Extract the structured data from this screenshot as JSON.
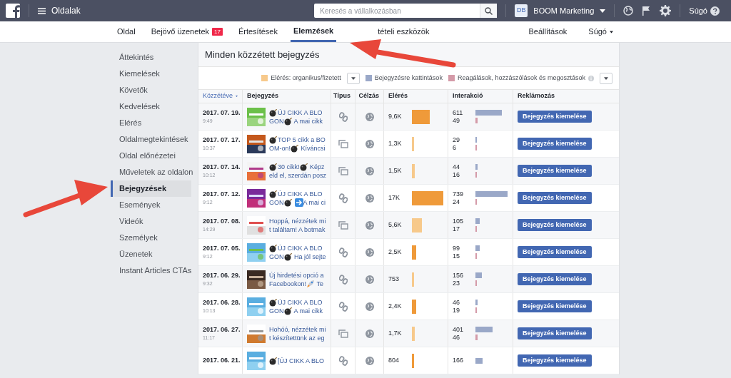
{
  "topbar": {
    "menu_label": "Oldalak",
    "search": {
      "placeholder": "Keresés a vállalkozásban"
    },
    "page": {
      "avatar": "DB",
      "name": "BOOM Marketing"
    },
    "help": "Súgó"
  },
  "nav": {
    "tabs": [
      {
        "label": "Oldal",
        "selected": false
      },
      {
        "label": "Bejövő üzenetek",
        "badge": "17",
        "selected": false
      },
      {
        "label": "Értesítések",
        "selected": false
      },
      {
        "label": "Elemzések",
        "selected": true
      },
      {
        "label": "tételi eszközök",
        "selected": false
      }
    ],
    "right": [
      {
        "label": "Beállítások",
        "dropdown": false
      },
      {
        "label": "Súgó",
        "dropdown": true
      }
    ]
  },
  "sidebar": {
    "items": [
      {
        "label": "Áttekintés",
        "selected": false
      },
      {
        "label": "Kiemelések",
        "selected": false
      },
      {
        "label": "Követők",
        "selected": false
      },
      {
        "label": "Kedvelések",
        "selected": false
      },
      {
        "label": "Elérés",
        "selected": false
      },
      {
        "label": "Oldalmegtekintések",
        "selected": false
      },
      {
        "label": "Oldal előnézetei",
        "selected": false
      },
      {
        "label": "Műveletek az oldalon",
        "selected": false
      },
      {
        "label": "Bejegyzések",
        "selected": true
      },
      {
        "label": "Események",
        "selected": false
      },
      {
        "label": "Videók",
        "selected": false
      },
      {
        "label": "Személyek",
        "selected": false
      },
      {
        "label": "Üzenetek",
        "selected": false
      },
      {
        "label": "Instant Articles CTAs",
        "selected": false
      }
    ]
  },
  "panel": {
    "title": "Minden közzétett bejegyzés",
    "legend": [
      {
        "kind": "swatch",
        "label": "Elérés: organikus/fizetett",
        "color": "#f7c98b"
      },
      {
        "kind": "dropdown"
      },
      {
        "kind": "swatch",
        "label": "Bejegyzésre kattintások",
        "color": "#9aa8c8"
      },
      {
        "kind": "swatch",
        "label": "Reagálások, hozzászólások és megosztások",
        "color": "#d49aa8"
      },
      {
        "kind": "info"
      },
      {
        "kind": "dropdown"
      }
    ],
    "columns": [
      {
        "label": "Közzétéve",
        "sorted": true
      },
      {
        "label": "Bejegyzés",
        "sorted": false
      },
      {
        "label": "Típus",
        "sorted": false
      },
      {
        "label": "Célzás",
        "sorted": false
      },
      {
        "label": "Elérés",
        "sorted": false
      },
      {
        "label": "Interakció",
        "sorted": false
      },
      {
        "label": "Reklámozás",
        "sorted": false
      }
    ],
    "rows": [
      {
        "date": "2017. 07. 19.",
        "time": "9:49",
        "post": [
          [
            {
              "kind": "bomb"
            },
            {
              "kind": "text",
              "text": "ÚJ CIKK A BLO"
            }
          ],
          [
            {
              "kind": "text",
              "text": "GON"
            },
            {
              "kind": "bomb"
            },
            {
              "kind": "text",
              "text": " A mai cikk"
            }
          ]
        ],
        "kind": "link",
        "reach": {
          "text": "9,6K",
          "color": "#ef9a3a"
        },
        "clicks": {
          "text": "611"
        },
        "reactions": {
          "text": "49"
        },
        "button": "Bejegyzés kiemelése"
      },
      {
        "date": "2017. 07. 17.",
        "time": "10:37",
        "post": [
          [
            {
              "kind": "bomb"
            },
            {
              "kind": "text",
              "text": "TOP 5 cikk a BO"
            }
          ],
          [
            {
              "kind": "text",
              "text": "OM-on!"
            },
            {
              "kind": "bomb"
            },
            {
              "kind": "text",
              "text": " Kíváncsi"
            }
          ]
        ],
        "kind": "album",
        "reach": {
          "text": "1,3K",
          "color": "#f7c98b"
        },
        "clicks": {
          "text": "29"
        },
        "reactions": {
          "text": "6"
        },
        "button": "Bejegyzés kiemelése"
      },
      {
        "date": "2017. 07. 14.",
        "time": "10:12",
        "post": [
          [
            {
              "kind": "bomb"
            },
            {
              "kind": "text",
              "text": "30 cikk!"
            },
            {
              "kind": "bomb"
            },
            {
              "kind": "text",
              "text": " Képz"
            }
          ],
          [
            {
              "kind": "text",
              "text": "eld el, szerdán posz"
            }
          ]
        ],
        "kind": "album",
        "reach": {
          "text": "1,5K",
          "color": "#f7c98b"
        },
        "clicks": {
          "text": "44"
        },
        "reactions": {
          "text": "16"
        },
        "button": "Bejegyzés kiemelése"
      },
      {
        "date": "2017. 07. 12.",
        "time": "9:12",
        "post": [
          [
            {
              "kind": "bomb"
            },
            {
              "kind": "text",
              "text": "ÚJ CIKK A BLO"
            }
          ],
          [
            {
              "kind": "text",
              "text": "GON"
            },
            {
              "kind": "bomb"
            },
            {
              "kind": "arrow"
            },
            {
              "kind": "text",
              "text": "A mai ci"
            }
          ]
        ],
        "kind": "link",
        "reach": {
          "text": "17K",
          "color": "#ef9a3a"
        },
        "clicks": {
          "text": "739"
        },
        "reactions": {
          "text": "24"
        },
        "button": "Bejegyzés kiemelése"
      },
      {
        "date": "2017. 07. 08.",
        "time": "14:29",
        "post": [
          [
            {
              "kind": "text",
              "text": "Hoppá, nézzétek mi"
            }
          ],
          [
            {
              "kind": "text",
              "text": "t találtam! A botmak"
            }
          ]
        ],
        "kind": "album",
        "reach": {
          "text": "5,6K",
          "color": "#f7c98b"
        },
        "clicks": {
          "text": "105"
        },
        "reactions": {
          "text": "17"
        },
        "button": "Bejegyzés kiemelése"
      },
      {
        "date": "2017. 07. 05.",
        "time": "9:12",
        "post": [
          [
            {
              "kind": "bomb"
            },
            {
              "kind": "text",
              "text": "ÚJ CIKK A BLO"
            }
          ],
          [
            {
              "kind": "text",
              "text": "GON"
            },
            {
              "kind": "bomb"
            },
            {
              "kind": "text",
              "text": " Ha jól sejte"
            }
          ]
        ],
        "kind": "link",
        "reach": {
          "text": "2,5K",
          "color": "#ef9a3a"
        },
        "clicks": {
          "text": "99"
        },
        "reactions": {
          "text": "15"
        },
        "button": "Bejegyzés kiemelése"
      },
      {
        "date": "2017. 06. 29.",
        "time": "9:32",
        "post": [
          [
            {
              "kind": "text",
              "text": "Új hirdetési opció a"
            }
          ],
          [
            {
              "kind": "text",
              "text": "Facebookon!"
            },
            {
              "kind": "rocket"
            },
            {
              "kind": "text",
              "text": " Te"
            }
          ]
        ],
        "kind": "link",
        "reach": {
          "text": "753",
          "color": "#f7c98b"
        },
        "clicks": {
          "text": "156"
        },
        "reactions": {
          "text": "23"
        },
        "button": "Bejegyzés kiemelése"
      },
      {
        "date": "2017. 06. 28.",
        "time": "10:13",
        "post": [
          [
            {
              "kind": "bomb"
            },
            {
              "kind": "text",
              "text": "ÚJ CIKK A BLO"
            }
          ],
          [
            {
              "kind": "text",
              "text": "GON"
            },
            {
              "kind": "bomb"
            },
            {
              "kind": "text",
              "text": " A mai cikk"
            }
          ]
        ],
        "kind": "link",
        "reach": {
          "text": "2,4K",
          "color": "#ef9a3a"
        },
        "clicks": {
          "text": "46"
        },
        "reactions": {
          "text": "19"
        },
        "button": "Bejegyzés kiemelése"
      },
      {
        "date": "2017. 06. 27.",
        "time": "11:17",
        "post": [
          [
            {
              "kind": "text",
              "text": "Hohóó, nézzétek mi"
            }
          ],
          [
            {
              "kind": "text",
              "text": "t készítettünk az eg"
            }
          ]
        ],
        "kind": "album",
        "reach": {
          "text": "1,7K",
          "color": "#f7c98b"
        },
        "clicks": {
          "text": "401"
        },
        "reactions": {
          "text": "46"
        },
        "button": "Bejegyzés kiemelése"
      },
      {
        "date": "2017. 06. 21.",
        "post": [
          [
            {
              "kind": "bomb"
            },
            {
              "kind": "text",
              "text": "[ÚJ CIKK A BLO"
            }
          ]
        ],
        "kind": "link",
        "reach": {
          "text": "804",
          "color": "#ef9a3a"
        },
        "clicks": {
          "text": "166"
        },
        "button": "Bejegyzés kiemelése"
      }
    ]
  }
}
